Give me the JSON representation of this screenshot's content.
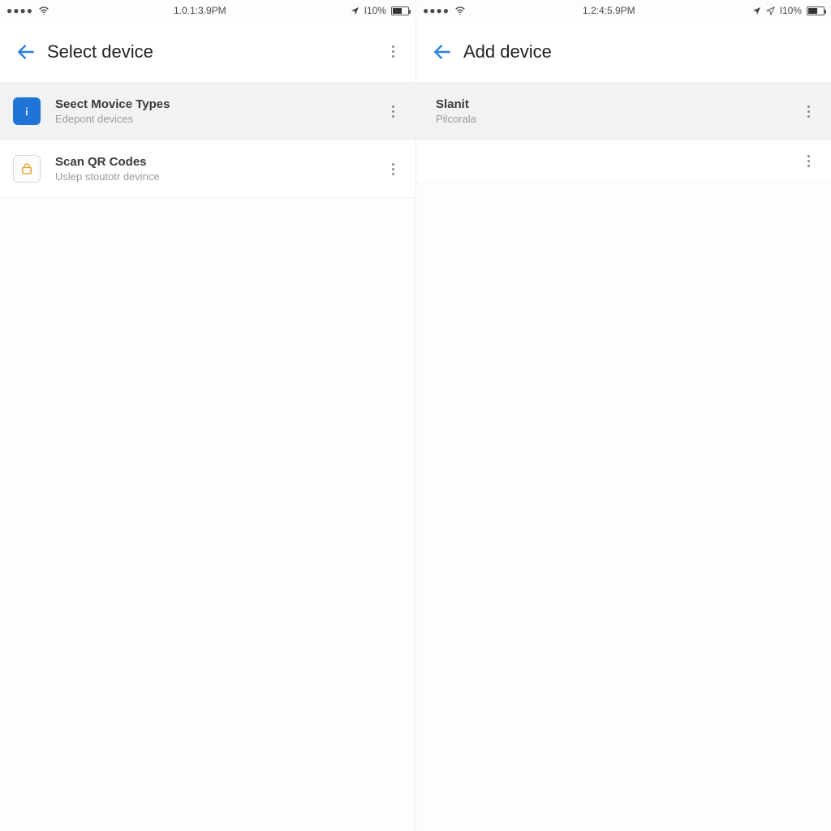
{
  "left": {
    "status": {
      "time": "1.0.1:3.9PM",
      "battery_pct": "I10%"
    },
    "header": {
      "title": "Select device"
    },
    "rows": [
      {
        "icon": "info",
        "title": "Seect Movice Types",
        "sub": "Edepont devices"
      },
      {
        "icon": "lock",
        "title": "Scan QR Codes",
        "sub": "Uslep stoutotr devince"
      }
    ]
  },
  "right": {
    "status": {
      "time": "1.2:4:5.9PM",
      "battery_pct": "I10%"
    },
    "header": {
      "title": "Add device"
    },
    "rows": [
      {
        "icon": "none",
        "title": "Slanit",
        "sub": "Pilcorala"
      },
      {
        "icon": "none",
        "title": "",
        "sub": ""
      }
    ]
  }
}
